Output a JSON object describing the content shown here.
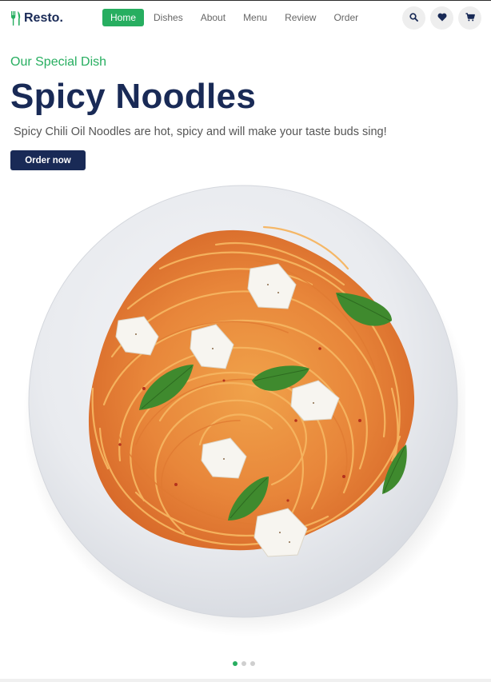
{
  "header": {
    "logo_text": "Resto.",
    "logo_icon": "utensils-icon",
    "nav": [
      {
        "label": "Home",
        "active": true
      },
      {
        "label": "Dishes",
        "active": false
      },
      {
        "label": "About",
        "active": false
      },
      {
        "label": "Menu",
        "active": false
      },
      {
        "label": "Review",
        "active": false
      },
      {
        "label": "Order",
        "active": false
      }
    ],
    "icons": [
      "search-icon",
      "heart-icon",
      "cart-icon"
    ]
  },
  "hero": {
    "eyebrow": "Our Special Dish",
    "title": "Spicy Noodles",
    "description": "Spicy Chili Oil Noodles are hot, spicy and will make your taste buds sing!",
    "cta_label": "Order now"
  },
  "slider": {
    "dot_count": 3,
    "active_index": 0
  },
  "colors": {
    "brand_green": "#27ae60",
    "navy": "#192a56",
    "text_gray": "#555555",
    "icon_bg": "#eeeeee"
  }
}
